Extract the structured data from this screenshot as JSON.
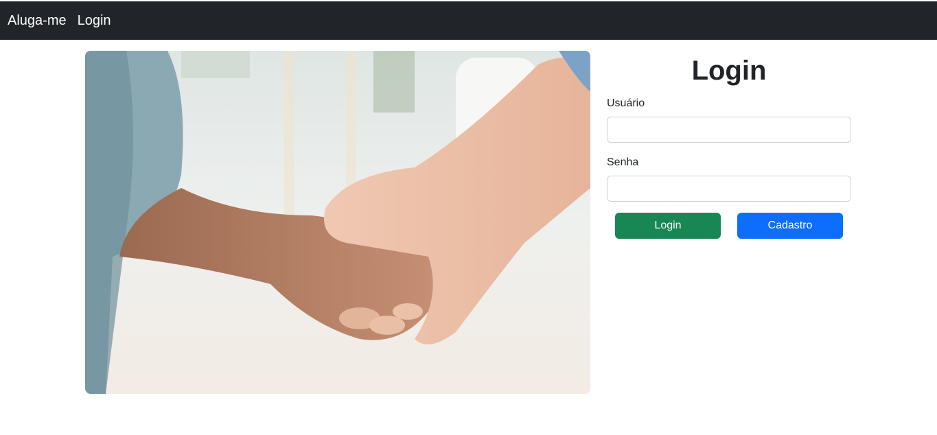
{
  "navbar": {
    "brand": "Aluga-me",
    "link_login": "Login"
  },
  "login": {
    "title": "Login",
    "username_label": "Usuário",
    "username_value": "",
    "password_label": "Senha",
    "password_value": "",
    "login_button": "Login",
    "register_button": "Cadastro"
  },
  "colors": {
    "navbar_bg": "#212529",
    "login_button": "#198754",
    "register_button": "#0d6efd"
  },
  "image": {
    "subject": "handshake-photo"
  }
}
